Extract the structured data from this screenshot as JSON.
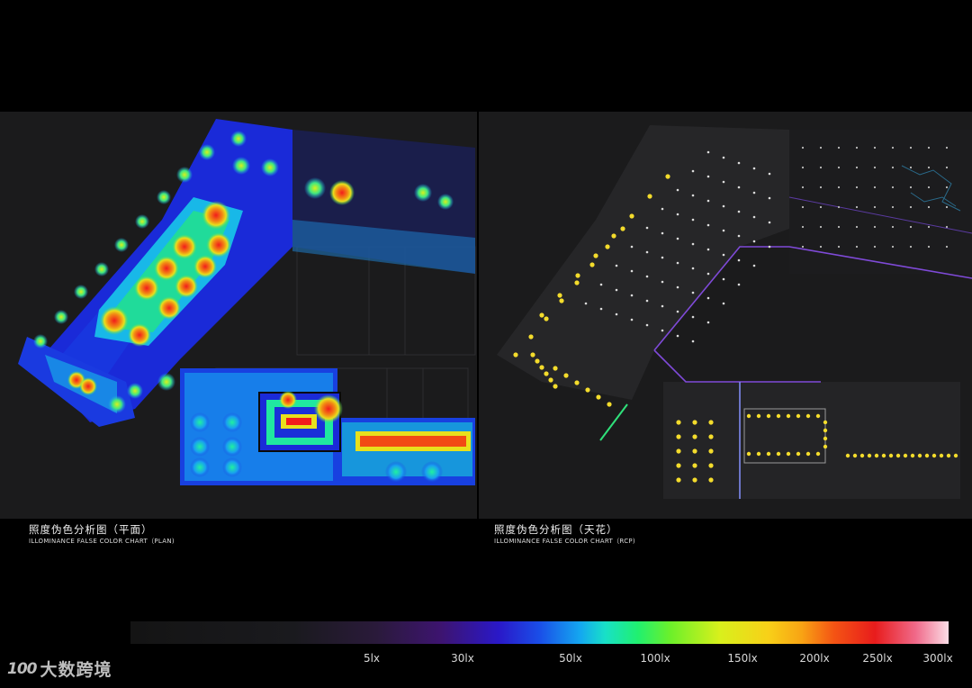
{
  "plan": {
    "caption_cn": "照度伪色分析图（平面）",
    "caption_en": "ILLOMINANCE FALSE COLOR CHART（PLAN)"
  },
  "rcp": {
    "caption_cn": "照度伪色分析图（天花）",
    "caption_en": "ILLOMINANCE FALSE COLOR CHART（RCP)"
  },
  "legend": {
    "labels": [
      "5lx",
      "30lx",
      "50lx",
      "100lx",
      "150lx",
      "200lx",
      "250lx",
      "300lx"
    ]
  },
  "watermark": {
    "mark": "100",
    "text": "大数跨境"
  },
  "colors": {
    "background": "#000000",
    "panel": "#1b1b1c",
    "low": "#1a2ad8",
    "mid": "#20e0a0",
    "high": "#e81c1c",
    "fixture": "#f4dc2c"
  }
}
